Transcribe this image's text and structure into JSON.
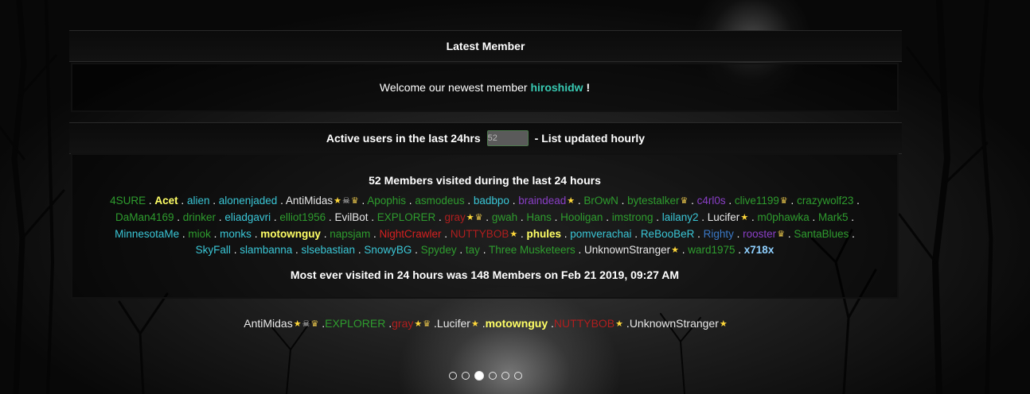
{
  "latest_member": {
    "header": "Latest Member",
    "welcome_text": "Welcome our newest member",
    "newest_name": "hiroshidw",
    "exclaim": "!"
  },
  "active_users": {
    "header_text": "Active users in the last 24hrs",
    "count": "52",
    "update_note": "- List updated hourly",
    "visited_title": "52 Members visited during the last 24 hours",
    "most_ever": "Most ever visited in 24 hours was 148 Members on Feb 21 2019, 09:27 AM",
    "members": [
      {
        "name": "4SURE",
        "color": "#2e9c2e",
        "bold": false,
        "icons": []
      },
      {
        "name": "Acet",
        "color": "#ffff66",
        "bold": true,
        "icons": []
      },
      {
        "name": "alien",
        "color": "#3ac6d6",
        "bold": false,
        "icons": []
      },
      {
        "name": "alonenjaded",
        "color": "#3ac6d6",
        "bold": false,
        "icons": []
      },
      {
        "name": "AntiMidas",
        "color": "#e8e8e8",
        "bold": false,
        "icons": [
          "star",
          "skull",
          "crown"
        ]
      },
      {
        "name": "Apophis",
        "color": "#2e9c2e",
        "bold": false,
        "icons": []
      },
      {
        "name": "asmodeus",
        "color": "#2e9c2e",
        "bold": false,
        "icons": []
      },
      {
        "name": "badbpo",
        "color": "#3ac6d6",
        "bold": false,
        "icons": []
      },
      {
        "name": "braindead",
        "color": "#8a3fc7",
        "bold": false,
        "icons": [
          "star"
        ]
      },
      {
        "name": "BrOwN",
        "color": "#2e9c2e",
        "bold": false,
        "icons": []
      },
      {
        "name": "bytestalker",
        "color": "#2e9c2e",
        "bold": false,
        "icons": [
          "crown"
        ]
      },
      {
        "name": "c4rl0s",
        "color": "#8a3fc7",
        "bold": false,
        "icons": []
      },
      {
        "name": "clive1199",
        "color": "#2e9c2e",
        "bold": false,
        "icons": [
          "crown"
        ]
      },
      {
        "name": "crazywolf23",
        "color": "#2e9c2e",
        "bold": false,
        "icons": []
      },
      {
        "name": "DaMan4169",
        "color": "#2e9c2e",
        "bold": false,
        "icons": []
      },
      {
        "name": "drinker",
        "color": "#2e9c2e",
        "bold": false,
        "icons": []
      },
      {
        "name": "eliadgavri",
        "color": "#3ac6d6",
        "bold": false,
        "icons": []
      },
      {
        "name": "elliot1956",
        "color": "#2e9c2e",
        "bold": false,
        "icons": []
      },
      {
        "name": "EvilBot",
        "color": "#e8e8e8",
        "bold": false,
        "icons": []
      },
      {
        "name": "EXPLORER",
        "color": "#2e9c2e",
        "bold": false,
        "icons": []
      },
      {
        "name": "gray",
        "color": "#b01e1e",
        "bold": false,
        "icons": [
          "star",
          "crown"
        ]
      },
      {
        "name": "gwah",
        "color": "#2e9c2e",
        "bold": false,
        "icons": []
      },
      {
        "name": "Hans",
        "color": "#2e9c2e",
        "bold": false,
        "icons": []
      },
      {
        "name": "Hooligan",
        "color": "#2e9c2e",
        "bold": false,
        "icons": []
      },
      {
        "name": "imstrong",
        "color": "#2e9c2e",
        "bold": false,
        "icons": []
      },
      {
        "name": "lailany2",
        "color": "#3ac6d6",
        "bold": false,
        "icons": []
      },
      {
        "name": "Lucifer",
        "color": "#e8e8e8",
        "bold": false,
        "icons": [
          "star"
        ]
      },
      {
        "name": "m0phawka",
        "color": "#2e9c2e",
        "bold": false,
        "icons": []
      },
      {
        "name": "Mark5",
        "color": "#2e9c2e",
        "bold": false,
        "icons": []
      },
      {
        "name": "MinnesotaMe",
        "color": "#3ac6d6",
        "bold": false,
        "icons": []
      },
      {
        "name": "miok",
        "color": "#2e9c2e",
        "bold": false,
        "icons": []
      },
      {
        "name": "monks",
        "color": "#3ac6d6",
        "bold": false,
        "icons": []
      },
      {
        "name": "motownguy",
        "color": "#ffff66",
        "bold": true,
        "icons": []
      },
      {
        "name": "napsjam",
        "color": "#2e9c2e",
        "bold": false,
        "icons": []
      },
      {
        "name": "NightCrawler",
        "color": "#d62020",
        "bold": false,
        "icons": []
      },
      {
        "name": "NUTTYBOB",
        "color": "#b01e1e",
        "bold": false,
        "icons": [
          "star"
        ]
      },
      {
        "name": "phules",
        "color": "#ffff66",
        "bold": true,
        "icons": []
      },
      {
        "name": "pomverachai",
        "color": "#3ac6d6",
        "bold": false,
        "icons": []
      },
      {
        "name": "ReBooBeR",
        "color": "#3ac6d6",
        "bold": false,
        "icons": []
      },
      {
        "name": "Righty",
        "color": "#3a78c6",
        "bold": false,
        "icons": []
      },
      {
        "name": "rooster",
        "color": "#8a3fc7",
        "bold": false,
        "icons": [
          "crown"
        ]
      },
      {
        "name": "SantaBlues",
        "color": "#2e9c2e",
        "bold": false,
        "icons": []
      },
      {
        "name": "SkyFall",
        "color": "#3ac6d6",
        "bold": false,
        "icons": []
      },
      {
        "name": "slambanna",
        "color": "#3ac6d6",
        "bold": false,
        "icons": []
      },
      {
        "name": "slsebastian",
        "color": "#3ac6d6",
        "bold": false,
        "icons": []
      },
      {
        "name": "SnowyBG",
        "color": "#3ac6d6",
        "bold": false,
        "icons": []
      },
      {
        "name": "Spydey",
        "color": "#2e9c2e",
        "bold": false,
        "icons": []
      },
      {
        "name": "tay",
        "color": "#2e9c2e",
        "bold": false,
        "icons": []
      },
      {
        "name": "Three Musketeers",
        "color": "#2e9c2e",
        "bold": false,
        "icons": []
      },
      {
        "name": "UnknownStranger",
        "color": "#e8e8e8",
        "bold": false,
        "icons": [
          "star"
        ]
      },
      {
        "name": "ward1975",
        "color": "#2e9c2e",
        "bold": false,
        "icons": []
      },
      {
        "name": "x718x",
        "color": "#8fd0ff",
        "bold": true,
        "icons": []
      }
    ]
  },
  "staff_online": {
    "members": [
      {
        "name": "AntiMidas",
        "color": "#e8e8e8",
        "bold": false,
        "icons": [
          "star",
          "skull",
          "crown"
        ]
      },
      {
        "name": "EXPLORER",
        "color": "#2e9c2e",
        "bold": false,
        "icons": []
      },
      {
        "name": "gray",
        "color": "#b01e1e",
        "bold": false,
        "icons": [
          "star",
          "crown"
        ]
      },
      {
        "name": "Lucifer",
        "color": "#e8e8e8",
        "bold": false,
        "icons": [
          "star"
        ]
      },
      {
        "name": "motownguy",
        "color": "#ffff66",
        "bold": true,
        "icons": []
      },
      {
        "name": "NUTTYBOB",
        "color": "#b01e1e",
        "bold": false,
        "icons": [
          "star"
        ]
      },
      {
        "name": "UnknownStranger",
        "color": "#e8e8e8",
        "bold": false,
        "icons": [
          "star"
        ]
      }
    ]
  },
  "icon_map": {
    "star": "★",
    "skull": "☠",
    "crown": "♛"
  },
  "carousel": {
    "total": 6,
    "active_index": 2
  }
}
